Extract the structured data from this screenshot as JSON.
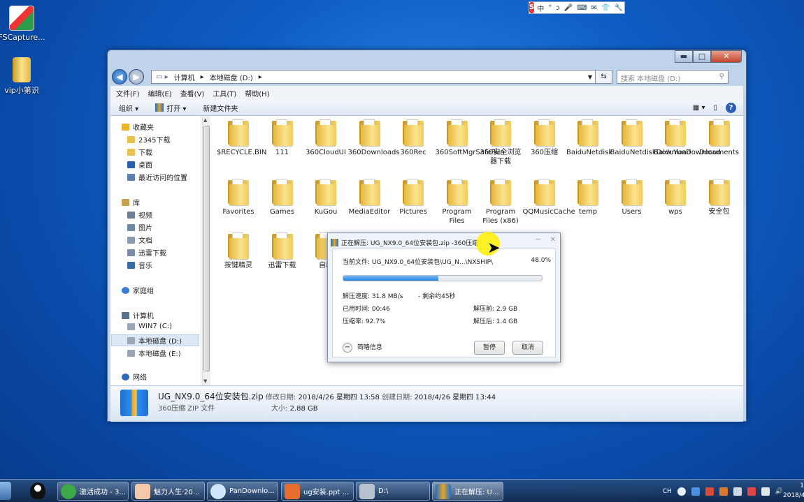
{
  "desktop": {
    "icons": [
      {
        "label": "FSCapture..."
      },
      {
        "label": "vip小第识"
      }
    ]
  },
  "ime": {
    "logo": "S",
    "glyphs": [
      "中",
      "°",
      "ↄ",
      "🎤",
      "⌨",
      "✉",
      "👕",
      "🔧"
    ]
  },
  "explorer": {
    "window_controls": {
      "minimize": "▬",
      "maximize": "□",
      "close": "✕"
    },
    "address": {
      "crumbs": [
        "计算机",
        "本地磁盘 (D:)"
      ],
      "sep": "▸"
    },
    "search_placeholder": "搜索 本地磁盘 (D:)",
    "menu": [
      "文件(F)",
      "编辑(E)",
      "查看(V)",
      "工具(T)",
      "帮助(H)"
    ],
    "toolbar": {
      "organize": "组织 ▾",
      "open": "打开 ▾",
      "new_folder": "新建文件夹"
    },
    "nav": {
      "favorites": "收藏夹",
      "fav_items": [
        "2345下载",
        "下载",
        "桌面",
        "最近访问的位置"
      ],
      "libraries": "库",
      "lib_items": [
        "视频",
        "图片",
        "文档",
        "迅雷下载",
        "音乐"
      ],
      "homegroup": "家庭组",
      "computer": "计算机",
      "drives": [
        "WIN7 (C:)",
        "本地磁盘 (D:)",
        "本地磁盘 (E:)"
      ],
      "network": "网络"
    },
    "files": [
      "$RECYCLE.BIN",
      "111",
      "360CloudUI",
      "360Downloads",
      "360Rec",
      "360SoftMgrSafeRun",
      "360安全浏览器下载",
      "360压缩",
      "BaiduNetdisk",
      "BaiduNetdiskDownload",
      "BaiduYunDownload",
      "Documents",
      "Favorites",
      "Games",
      "KuGou",
      "MediaEditor",
      "Pictures",
      "Program Files",
      "Program Files (x86)",
      "QQMusicCache",
      "temp",
      "Users",
      "wps",
      "安全包",
      "按键精灵",
      "迅雷下载",
      "自动"
    ],
    "details": {
      "filename": "UG_NX9.0_64位安装包.zip",
      "modified_label": "修改日期:",
      "modified": "2018/4/26 星期四 13:58",
      "created_label": "创建日期:",
      "created": "2018/4/26 星期四 13:44",
      "type": "360压缩 ZIP 文件",
      "size_label": "大小:",
      "size": "2.88 GB"
    }
  },
  "dialog": {
    "title": "正在解压: UG_NX9.0_64位安装包.zip -360压缩",
    "current_label": "当前文件:",
    "current_file": "UG_NX9.0_64位安装包\\UG_N...\\NXSHIP\\",
    "percent": "48.0%",
    "progress": 0.48,
    "speed": "解压速度: 31.8 MB/s",
    "remaining": "- 剩余约45秒",
    "elapsed": "已用时间: 00:46",
    "before": "解压前: 2.9 GB",
    "ratio": "压缩率: 92.7%",
    "after": "解压后: 1.4 GB",
    "brief": "简略信息",
    "pause": "暂停",
    "cancel": "取消"
  },
  "taskbar": {
    "tasks": [
      "激活成功 - 3...",
      "魅力人生·20...",
      "PanDownlo...",
      "ug安装.ppt ...",
      "D:\\",
      "正在解压: U..."
    ],
    "tray_lang": "CH",
    "clock": [
      "1",
      "2018/4"
    ]
  },
  "colors": {
    "accent": "#2a83dc",
    "taskbar": "#1b3a66",
    "folder": "#f0cf63"
  }
}
